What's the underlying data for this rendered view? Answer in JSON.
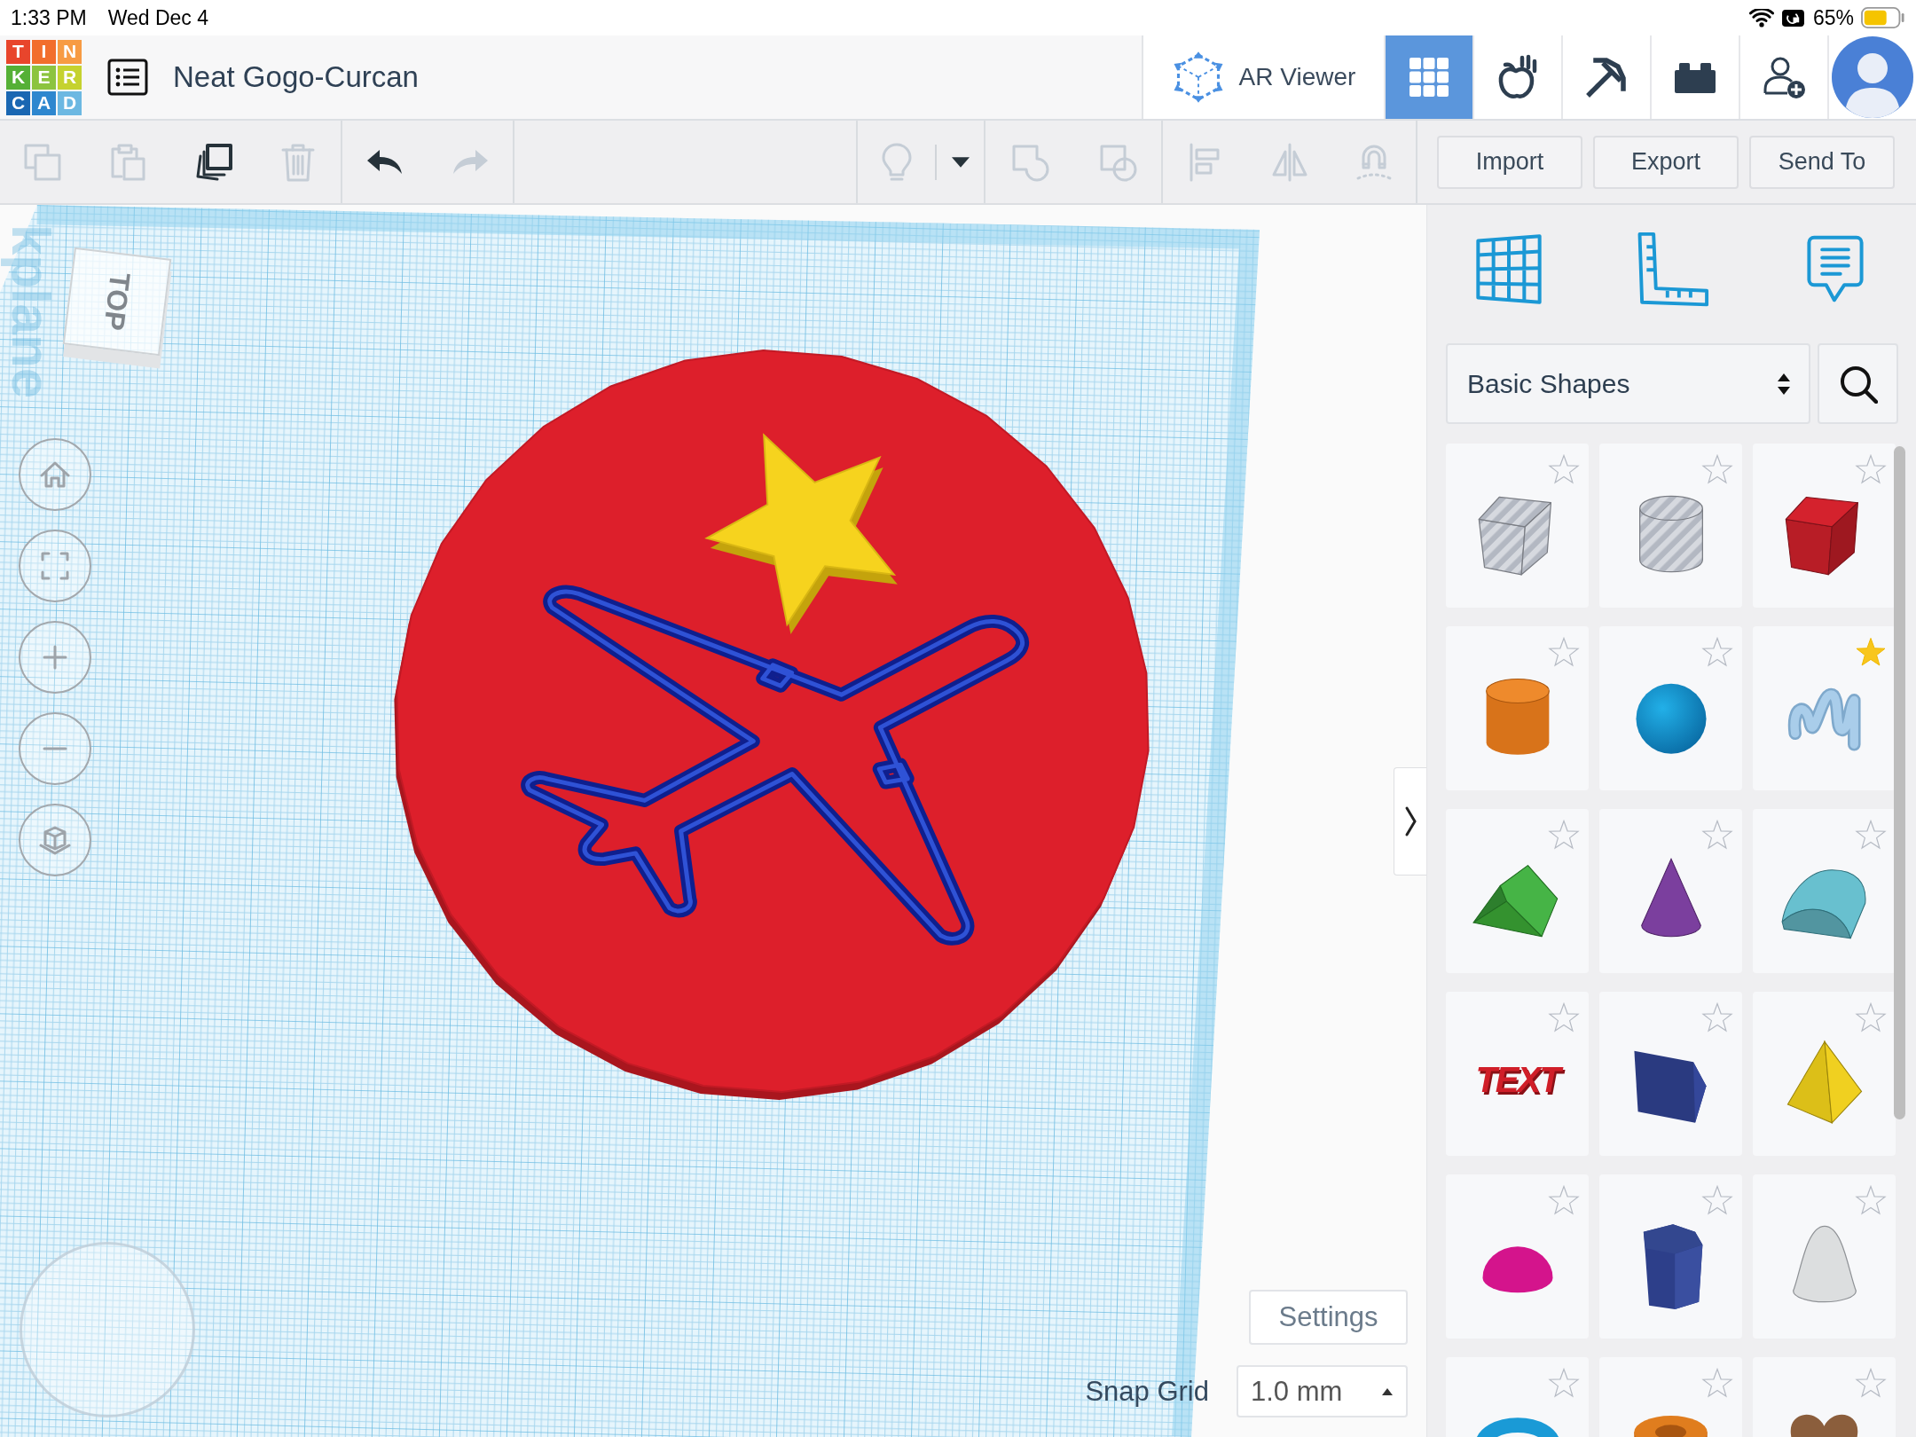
{
  "status_bar": {
    "time": "1:33 PM",
    "date": "Wed Dec 4",
    "battery": "65%"
  },
  "header": {
    "logo": [
      {
        "letter": "T",
        "color": "#e8452c"
      },
      {
        "letter": "I",
        "color": "#f26e2c"
      },
      {
        "letter": "N",
        "color": "#f79b43"
      },
      {
        "letter": "K",
        "color": "#55b036"
      },
      {
        "letter": "E",
        "color": "#8cc43f"
      },
      {
        "letter": "R",
        "color": "#c5d22f"
      },
      {
        "letter": "C",
        "color": "#1a67b2"
      },
      {
        "letter": "A",
        "color": "#2e87cf"
      },
      {
        "letter": "D",
        "color": "#6cb8e2"
      }
    ],
    "title": "Neat Gogo-Curcan",
    "ar_viewer": "AR Viewer",
    "modes": [
      {
        "kind": "grid",
        "selected": true
      },
      {
        "kind": "apple",
        "selected": false
      },
      {
        "kind": "pickaxe",
        "selected": false
      },
      {
        "kind": "brick",
        "selected": false
      }
    ]
  },
  "toolbar": {
    "left_groups": [
      {
        "tools": [
          {
            "kind": "copy",
            "disabled": true
          },
          {
            "kind": "paste",
            "disabled": true
          },
          {
            "kind": "duplicate",
            "disabled": false
          },
          {
            "kind": "delete",
            "disabled": true
          }
        ]
      },
      {
        "tools": [
          {
            "kind": "undo",
            "disabled": false
          },
          {
            "kind": "redo",
            "disabled": true
          }
        ]
      }
    ],
    "right_groups": [
      {
        "tools": [
          {
            "kind": "bulb",
            "disabled": true
          },
          {
            "kind": "caret",
            "disabled": false
          }
        ]
      },
      {
        "tools": [
          {
            "kind": "group",
            "disabled": true
          },
          {
            "kind": "ungroup",
            "disabled": true
          }
        ]
      },
      {
        "tools": [
          {
            "kind": "align",
            "disabled": true
          },
          {
            "kind": "mirror",
            "disabled": true
          },
          {
            "kind": "magnet",
            "disabled": true
          }
        ]
      }
    ],
    "buttons": [
      "Import",
      "Export",
      "Send To"
    ]
  },
  "canvas": {
    "workplane_label": "kplane",
    "view_cube": "TOP",
    "nav_buttons": [
      {
        "kind": "home"
      },
      {
        "kind": "fit"
      },
      {
        "kind": "zoom-in"
      },
      {
        "kind": "zoom-out"
      },
      {
        "kind": "perspective"
      }
    ],
    "objects": [
      {
        "kind": "disc"
      },
      {
        "kind": "star"
      },
      {
        "kind": "airplane"
      }
    ],
    "settings": "Settings",
    "snap_grid": {
      "label": "Snap Grid",
      "value": "1.0 mm"
    }
  },
  "panel": {
    "tools": [
      {
        "kind": "workplane"
      },
      {
        "kind": "ruler"
      },
      {
        "kind": "notes"
      }
    ],
    "category": "Basic Shapes",
    "shapes": [
      {
        "kind": "box-hole",
        "favorite": false
      },
      {
        "kind": "cylinder-hole",
        "favorite": false
      },
      {
        "kind": "box",
        "favorite": false
      },
      {
        "kind": "cylinder",
        "favorite": false
      },
      {
        "kind": "sphere",
        "favorite": false
      },
      {
        "kind": "scribble",
        "favorite": true
      },
      {
        "kind": "roof",
        "favorite": false
      },
      {
        "kind": "cone",
        "favorite": false
      },
      {
        "kind": "round-roof",
        "favorite": false
      },
      {
        "kind": "text",
        "favorite": false,
        "text": "TEXT"
      },
      {
        "kind": "wedge",
        "favorite": false
      },
      {
        "kind": "pyramid",
        "favorite": false
      },
      {
        "kind": "half-sphere",
        "favorite": false
      },
      {
        "kind": "polygon",
        "favorite": false
      },
      {
        "kind": "paraboloid",
        "favorite": false
      },
      {
        "kind": "torus",
        "favorite": false
      },
      {
        "kind": "tube",
        "favorite": false
      },
      {
        "kind": "heart",
        "favorite": false
      }
    ]
  }
}
